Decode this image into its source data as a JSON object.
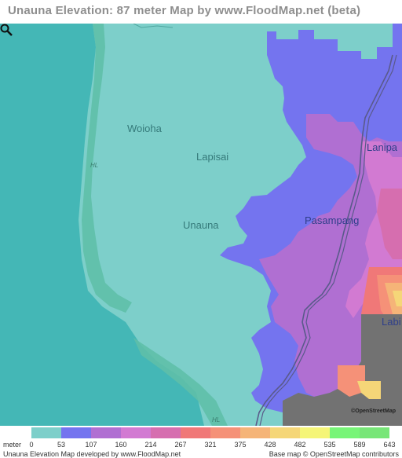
{
  "title": "Unauna Elevation: 87 meter Map by www.FloodMap.net (beta)",
  "map": {
    "places": [
      {
        "name": "Woioha",
        "style": "teal"
      },
      {
        "name": "Lapisai",
        "style": "teal"
      },
      {
        "name": "Unauna",
        "style": "teal"
      },
      {
        "name": "Pasampang",
        "style": "dark"
      },
      {
        "name": "Lanipa",
        "style": "dark"
      },
      {
        "name": "Labi",
        "style": "dark"
      }
    ],
    "road_label": "HL",
    "osm_badge": "©OpenStreetMap",
    "magnifier_icon": "magnifier-icon",
    "colors": {
      "sea": "#44b7b6",
      "lowland": "#7dcfca",
      "reef": "#5fbfa8",
      "gray_high": "#727272"
    }
  },
  "legend": {
    "unit": "meter",
    "ticks": [
      "0",
      "53",
      "107",
      "160",
      "214",
      "267",
      "321",
      "375",
      "428",
      "482",
      "535",
      "589",
      "643"
    ],
    "colors": [
      "#7dcfca",
      "#7474ef",
      "#b06fd2",
      "#d27ad2",
      "#d66eaf",
      "#f07878",
      "#f59178",
      "#f5b478",
      "#f5d678",
      "#f5f578",
      "#78f578",
      "#78e678"
    ]
  },
  "credits": {
    "left": "Unauna Elevation Map developed by www.FloodMap.net",
    "right": "Base map © OpenStreetMap contributors"
  }
}
